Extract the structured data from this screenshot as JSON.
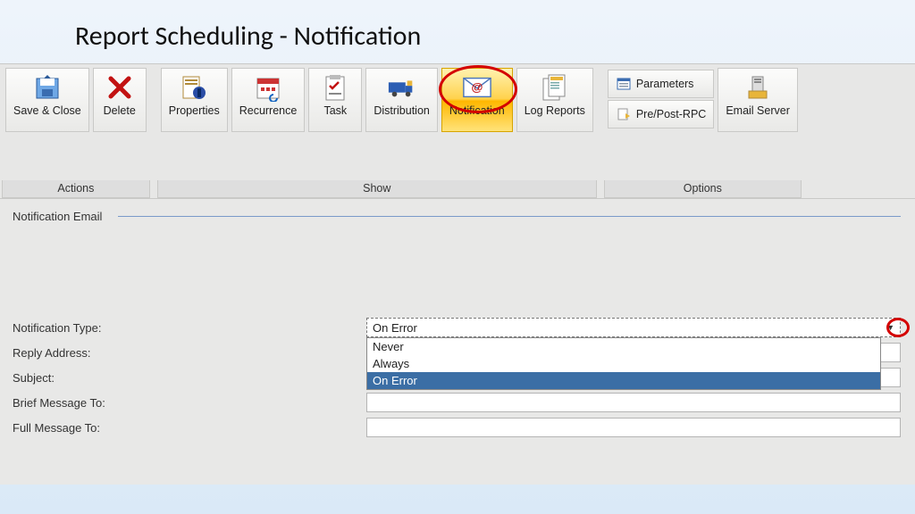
{
  "title": "Report Scheduling - Notification",
  "ribbon": {
    "groups": [
      {
        "label": "Actions",
        "buttons": [
          {
            "name": "save-close",
            "label": "Save & Close",
            "icon": "save-icon"
          },
          {
            "name": "delete",
            "label": "Delete",
            "icon": "delete-icon"
          }
        ]
      },
      {
        "label": "Show",
        "buttons": [
          {
            "name": "properties",
            "label": "Properties",
            "icon": "properties-icon"
          },
          {
            "name": "recurrence",
            "label": "Recurrence",
            "icon": "recurrence-icon"
          },
          {
            "name": "task",
            "label": "Task",
            "icon": "task-icon"
          },
          {
            "name": "distribution",
            "label": "Distribution",
            "icon": "distribution-icon"
          },
          {
            "name": "notification",
            "label": "Notification",
            "icon": "notification-icon",
            "selected": true
          },
          {
            "name": "log-reports",
            "label": "Log Reports",
            "icon": "log-reports-icon"
          }
        ]
      },
      {
        "label": "Options",
        "stack": [
          {
            "name": "parameters",
            "label": "Parameters",
            "icon": "parameters-icon"
          },
          {
            "name": "pre-post-rpc",
            "label": "Pre/Post-RPC",
            "icon": "rpc-icon"
          }
        ],
        "buttons": [
          {
            "name": "email-server",
            "label": "Email Server",
            "icon": "email-server-icon"
          }
        ]
      }
    ]
  },
  "form": {
    "group_title": "Notification Email",
    "fields": {
      "notification_type": {
        "label": "Notification Type:",
        "value": "On Error",
        "options": [
          "Never",
          "Always",
          "On Error"
        ],
        "highlighted": "On Error"
      },
      "reply_address": {
        "label": "Reply Address:",
        "value": ""
      },
      "subject": {
        "label": "Subject:",
        "value": ""
      },
      "brief_message_to": {
        "label": "Brief Message To:",
        "value": ""
      },
      "full_message_to": {
        "label": "Full Message To:",
        "value": ""
      }
    }
  }
}
